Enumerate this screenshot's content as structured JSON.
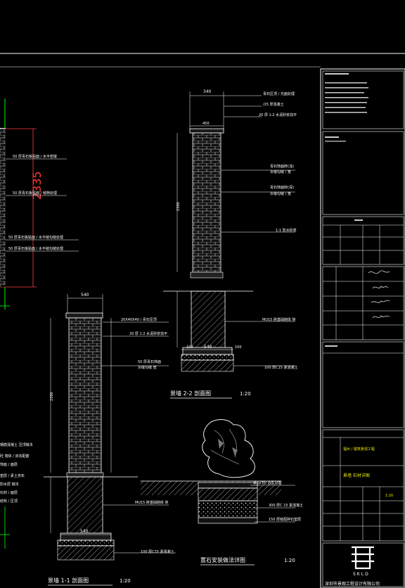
{
  "title_block": {
    "company": "SKLD",
    "company_name": "深圳市景观工程设计有限公司",
    "scale_value": "1:20"
  },
  "elevations": {
    "big_dim": "2335"
  },
  "wall_2_2": {
    "top_width": "340",
    "cap_width": "450",
    "height_above": "2390",
    "height_below": "1110",
    "foot_left": "100",
    "foot_mid": "540",
    "foot_right": "100",
    "title": "景墙  2-2 剖面图",
    "scale": "1:20"
  },
  "wall_1_1": {
    "top_width": "540",
    "height_above": "2390",
    "height_below": "1110",
    "foot_mid": "540",
    "title": "景墙  1-1 剖面图",
    "scale": "1:20"
  },
  "rock_detail": {
    "title": "置石安装做法详图",
    "scale": "1:20"
  },
  "colors": {
    "background": "#000000",
    "line": "#ffffff",
    "accent_red": "#ff3b3b",
    "accent_green": "#00ff00",
    "accent_cyan": "#00e5ff",
    "accent_yellow": "#e8e800"
  }
}
